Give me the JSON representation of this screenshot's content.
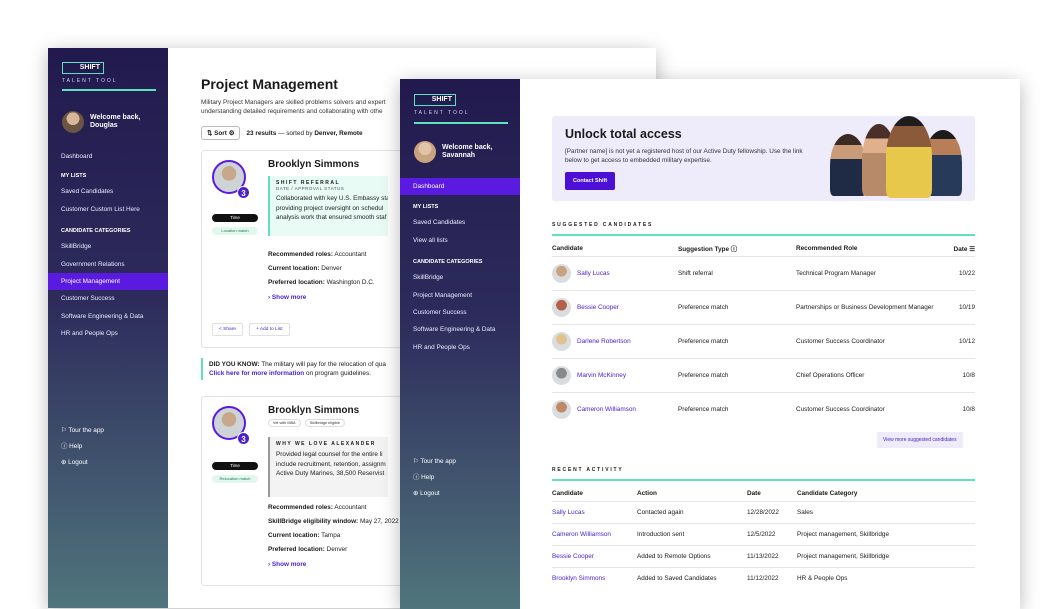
{
  "brand": {
    "logo": "SHIFT",
    "sub": "TALENT TOOL"
  },
  "win1": {
    "welcome": "Welcome back, Douglas",
    "nav": {
      "dashboard": "Dashboard",
      "my_lists": "MY LISTS",
      "saved": "Saved Candidates",
      "custom": "Customer Custom List Here",
      "categories": "CANDIDATE CATEGORIES",
      "cats": [
        "SkillBridge",
        "Government Relations",
        "Project Management",
        "Customer Success",
        "Software Engineering & Data",
        "HR and People Ops"
      ]
    },
    "footer": {
      "tour": "Tour the app",
      "help": "Help",
      "logout": "Logout"
    },
    "title": "Project Management",
    "desc": "Military Project Managers are skilled problems solvers and expert understanding detailed requirements and collaborating with othe",
    "sort": "Sort",
    "results_count": "23 results",
    "results_mid": " — sorted by ",
    "results_sort": "Denver, Remote",
    "card1": {
      "name": "Brooklyn Simmons",
      "badge": "3",
      "pill1": "Time",
      "pill2": "Location match",
      "ref_title": "SHIFT REFERRAL",
      "ref_sub": "DATE / APPROVAL STATUS",
      "ref_lines": [
        "Collaborated with key U.S. Embassy sta",
        "providing project oversight on schedul",
        "analysis work that ensured smooth staf"
      ],
      "roles_label": "Recommended roles:",
      "roles": " Accountant",
      "loc_label": "Current location:",
      "loc": " Denver",
      "pref_label": "Preferred location:",
      "pref": " Washington D.C.",
      "show_more": "Show more",
      "share": "Share",
      "add": "Add to List"
    },
    "dyk": {
      "label": "DID YOU KNOW:",
      "text": " The military will pay for the relocation of qua",
      "link": "Click here for more information",
      "rest": " on program guidelines."
    },
    "card2": {
      "name": "Brooklyn Simmons",
      "tags": [
        "Vet with MBA",
        "Skillbridge eligible"
      ],
      "badge": "3",
      "pill1": "Time",
      "pill2": "Relocation match",
      "ref_title": "WHY WE LOVE ALEXANDER",
      "ref_lines": [
        "Provided legal counsel for the entire li",
        "include recruitment, retention, assignm",
        "Active Duty Marines, 38,500 Reservist"
      ],
      "roles_label": "Recommended roles:",
      "roles": " Accountant",
      "sb_label": "SkillBridge eligibility window:",
      "sb": " May 27, 2022",
      "loc_label": "Current location:",
      "loc": " Tampa",
      "pref_label": "Preferred location:",
      "pref": " Denver",
      "show_more": "Show more"
    }
  },
  "win2": {
    "welcome": "Welcome back, Savannah",
    "nav": {
      "dashboard": "Dashboard",
      "my_lists": "MY LISTS",
      "saved": "Saved Candidates",
      "view_all": "View all lists",
      "categories": "CANDIDATE CATEGORIES",
      "cats": [
        "SkillBridge",
        "Project Management",
        "Customer Success",
        "Software Engineering & Data",
        "HR and People Ops"
      ]
    },
    "footer": {
      "tour": "Tour the app",
      "help": "Help",
      "logout": "Logout"
    },
    "hero": {
      "title": "Unlock total access",
      "body": "[Partner name] is not yet a registered host of our Active Duty fellowship. Use the link below to get access to embedded military expertise.",
      "cta": "Contact Shift"
    },
    "suggested": {
      "title": "SUGGESTED CANDIDATES",
      "headers": [
        "Candidate",
        "Suggestion Type",
        "Recommended Role",
        "Date"
      ],
      "rows": [
        {
          "name": "Sally Lucas",
          "type": "Shift referral",
          "role": "Technical Program Manager",
          "date": "10/22"
        },
        {
          "name": "Bessie Cooper",
          "type": "Preference match",
          "role": "Partnerships or Business Development Manager",
          "date": "10/19"
        },
        {
          "name": "Darlene Robertson",
          "type": "Preference match",
          "role": "Customer Success Coordinator",
          "date": "10/12"
        },
        {
          "name": "Marvin McKinney",
          "type": "Preference match",
          "role": "Chief Operations Officer",
          "date": "10/8"
        },
        {
          "name": "Cameron Williamson",
          "type": "Preference match",
          "role": "Customer Success Coordinator",
          "date": "10/8"
        }
      ],
      "view_more": "View more suggested candidates"
    },
    "recent": {
      "title": "RECENT ACTIVITY",
      "headers": [
        "Candidate",
        "Action",
        "Date",
        "Candidate Category"
      ],
      "rows": [
        {
          "name": "Sally Lucas",
          "action": "Contacted again",
          "date": "12/28/2022",
          "cat": "Sales"
        },
        {
          "name": "Cameron Williamson",
          "action": "Introduction sent",
          "date": "12/5/2022",
          "cat": "Project management, Skillbridge"
        },
        {
          "name": "Bessie Cooper",
          "action": "Added to Remote Options",
          "date": "11/13/2022",
          "cat": "Project management, Skillbridge"
        },
        {
          "name": "Brooklyn Simmons",
          "action": "Added to Saved Candidates",
          "date": "11/12/2022",
          "cat": "HR & People Ops"
        }
      ]
    }
  },
  "colors": {
    "accent": "#5b1ae0",
    "mint": "#61e0bf",
    "sidebar_top": "#221a4e",
    "sidebar_bottom": "#50757c"
  }
}
